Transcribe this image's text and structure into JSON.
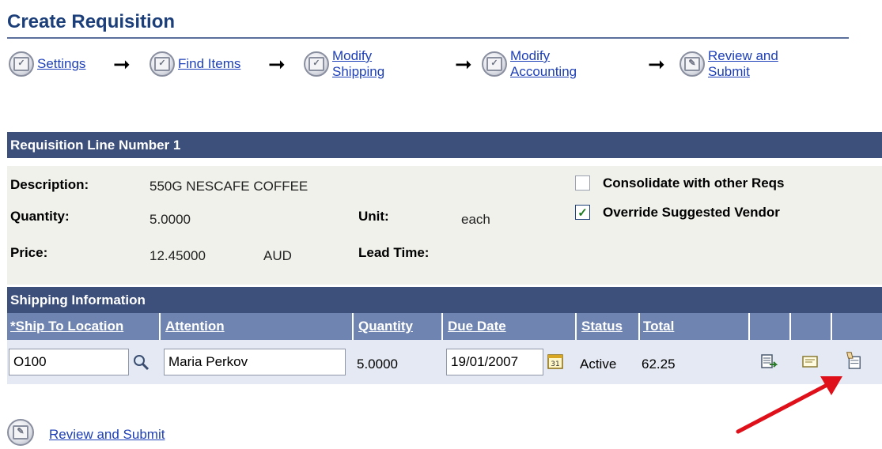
{
  "page": {
    "title": "Create Requisition"
  },
  "steps": [
    {
      "label": "Settings"
    },
    {
      "label": "Find Items"
    },
    {
      "label_line1": "Modify",
      "label_line2": "Shipping"
    },
    {
      "label_line1": "Modify",
      "label_line2": "Accounting"
    },
    {
      "label_line1": "Review and",
      "label_line2": "Submit"
    }
  ],
  "req_line": {
    "header": "Requisition Line Number 1",
    "description_label": "Description:",
    "description_value": "550G NESCAFE COFFEE",
    "quantity_label": "Quantity:",
    "quantity_value": "5.0000",
    "unit_label": "Unit:",
    "unit_value": "each",
    "price_label": "Price:",
    "price_value": "12.45000",
    "currency": "AUD",
    "lead_time_label": "Lead Time:",
    "consolidate_label": "Consolidate with other Reqs",
    "consolidate_checked": false,
    "override_label": "Override Suggested Vendor",
    "override_checked": true
  },
  "shipping": {
    "header": "Shipping Information",
    "columns": [
      "*Ship To Location",
      "Attention",
      "Quantity",
      "Due Date",
      "Status",
      "Total"
    ],
    "row": {
      "ship_to": "O100",
      "attention": "Maria Perkov",
      "quantity": "5.0000",
      "due_date": "19/01/2007",
      "status": "Active",
      "total": "62.25"
    }
  },
  "footer": {
    "review_submit_label": "Review and Submit"
  },
  "colors": {
    "header_bar": "#3d4f7b",
    "column_header": "#6f84b0",
    "link": "#1d3fb8",
    "title": "#1c3f7a",
    "annotation_arrow": "#e0101a"
  }
}
